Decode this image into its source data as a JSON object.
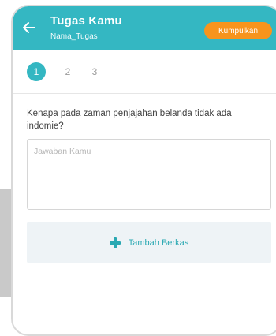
{
  "appbar": {
    "title": "Tugas Kamu",
    "subtitle": "Nama_Tugas",
    "submit_label": "Kumpulkan",
    "back_icon": "arrow-left-icon"
  },
  "steps": [
    {
      "label": "1",
      "active": true
    },
    {
      "label": "2",
      "active": false
    },
    {
      "label": "3",
      "active": false
    }
  ],
  "question": {
    "text": "Kenapa pada zaman penjajahan belanda tidak ada indomie?"
  },
  "answer": {
    "placeholder": "Jawaban Kamu",
    "value": ""
  },
  "attach": {
    "label": "Tambah Berkas",
    "icon": "plus-icon"
  },
  "colors": {
    "primary": "#34b7c2",
    "accent": "#f7941d",
    "attach_bg": "#eef3f6"
  }
}
